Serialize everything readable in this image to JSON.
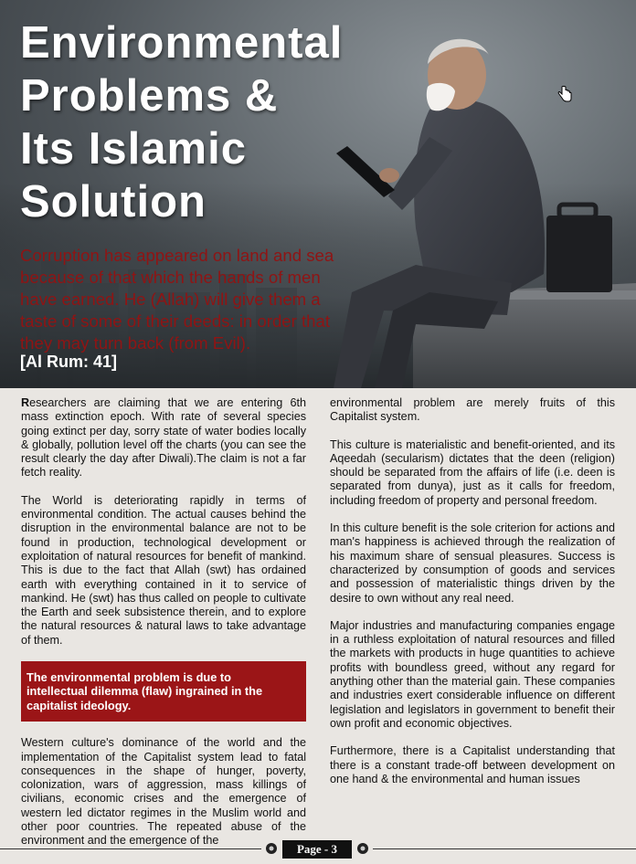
{
  "header": {
    "title_lines": [
      "Environmental",
      "Problems &",
      "Its Islamic",
      "Solution"
    ],
    "quote": "Corruption has appeared on land and sea because of that which the hands of men have earned. He (Allah) will give them a taste of some of their deeds: in order that they may turn back (from Evil).",
    "reference": "[Al Rum: 41]"
  },
  "left_column": {
    "p1_dropcap": "R",
    "p1_rest": "esearchers are claiming that we are entering 6th mass extinction epoch. With rate of several species going extinct per day, sorry state of water bodies locally & globally, pollution level off the charts (you can see the result clearly the day after Diwali).The claim is not a far fetch reality.",
    "p2": "The World is deteriorating rapidly in terms of environmental condition. The actual causes behind the disruption in the environmental balance are not to be found in production, technological development or exploitation of natural resources for benefit of mankind. This is due to the fact that Allah (swt) has ordained earth with everything contained in it to service of mankind. He (swt) has thus called on people to cultivate the Earth and seek subsistence therein, and to explore the natural resources & natural laws to take advantage of them.",
    "callout": "The environmental problem is due to intellectual dilemma (flaw) ingrained in the capitalist ideology.",
    "p3": "Western culture's dominance of the world and the implementation of the Capitalist system lead to fatal consequences in the shape of hunger, poverty, colonization, wars of aggression, mass killings of civilians, economic crises and the emergence of western led dictator regimes in the Muslim world and other poor countries. The repeated abuse of the environment and the emergence of the"
  },
  "right_column": {
    "p1": "environmental problem are merely fruits of this Capitalist system.",
    "p2": "This culture is materialistic and benefit-oriented, and its Aqeedah (secularism) dictates that the deen (religion) should be separated from the affairs of life (i.e. deen is separated from dunya), just as it calls for freedom, including freedom of property and personal freedom.",
    "p3": "In this culture benefit is the sole criterion for actions and man's happiness is achieved through the realization of his maximum share of sensual pleasures. Success is characterized by consumption of goods and services and possession of materialistic things driven by the desire to own without any real need.",
    "p4": "Major industries and manufacturing companies engage in a ruthless exploitation of natural resources and filled the markets with products in huge quantities to achieve profits with boundless greed, without any regard for anything other than the material gain. These companies and industries exert considerable influence on different legislation and legislators in government to benefit their own profit and economic objectives.",
    "p5": "Furthermore, there is a Capitalist understanding that there is a constant trade-off between development on one hand & the environmental and human issues"
  },
  "footer": {
    "page_label": "Page - 3"
  },
  "colors": {
    "title": "#ffffff",
    "quote": "#8f1414",
    "callout_bg": "#9b1517",
    "page_box": "#111111"
  }
}
